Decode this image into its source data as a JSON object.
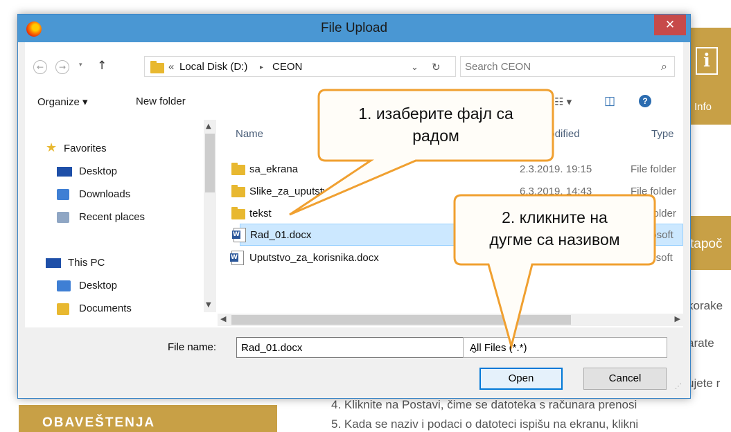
{
  "background": {
    "info_label": "Info",
    "info_icon": "i",
    "band_text": "tapoč",
    "lines": [
      "korake",
      "arate",
      "ujete r",
      "4. Kliknite na Postavi, čime se datoteka s računara prenosi",
      "5. Kada se naziv i podaci o datoteci ispišu na ekranu, klikni"
    ],
    "notice_title": "OBAVEŠTENJA"
  },
  "dialog": {
    "title": "File Upload",
    "close_glyph": "✕",
    "nav": {
      "back_glyph": "←",
      "forward_glyph": "→",
      "up_glyph": "↑",
      "path_prefix": "«",
      "path": [
        "Local Disk (D:)",
        "CEON"
      ],
      "separator": "▸",
      "refresh_glyph": "↻",
      "dropdown_glyph": "⌄"
    },
    "search": {
      "placeholder": "Search CEON",
      "icon_glyph": "⌕"
    },
    "toolbar": {
      "organize_label": "Organize ▾",
      "new_folder_label": "New folder",
      "view_glyph": "☷ ▾",
      "pane_glyph": "◫",
      "help_glyph": "?"
    },
    "navpane": {
      "favorites_label": "Favorites",
      "favorites": [
        "Desktop",
        "Downloads",
        "Recent places"
      ],
      "thispc_label": "This PC",
      "thispc": [
        "Desktop",
        "Documents"
      ]
    },
    "columns": {
      "name": "Name",
      "modified": "Date modified",
      "type": "Type"
    },
    "files": [
      {
        "name": "sa_ekrana",
        "date": "2.3.2019. 19:15",
        "type": "File folder",
        "kind": "folder",
        "selected": false
      },
      {
        "name": "Slike_za_uputstvo",
        "date": "6.3.2019. 14:43",
        "type": "File folder",
        "kind": "folder",
        "selected": false
      },
      {
        "name": "tekst",
        "date": "",
        "type": "File folder",
        "kind": "folder",
        "selected": false
      },
      {
        "name": "Rad_01.docx",
        "date": "",
        "type": "Microsoft",
        "kind": "doc",
        "selected": true
      },
      {
        "name": "Uputstvo_za_korisnika.docx",
        "date": "",
        "type": "Microsoft",
        "kind": "doc",
        "selected": false
      }
    ],
    "bottom": {
      "filename_label": "File name:",
      "filename_value": "Rad_01.docx",
      "filter_value": "All Files (*.*)",
      "open_label": "Open",
      "cancel_label": "Cancel"
    }
  },
  "callouts": [
    {
      "text": "1. изаберите фајл са\nрадом"
    },
    {
      "text": "2. кликните на\nдугме са називом"
    }
  ],
  "colors": {
    "accent_gold": "#c8a046",
    "callout_fill": "#fffdf8",
    "callout_border": "#f0a030",
    "titlebar": "#4a97d3",
    "selection": "#cce8ff"
  }
}
